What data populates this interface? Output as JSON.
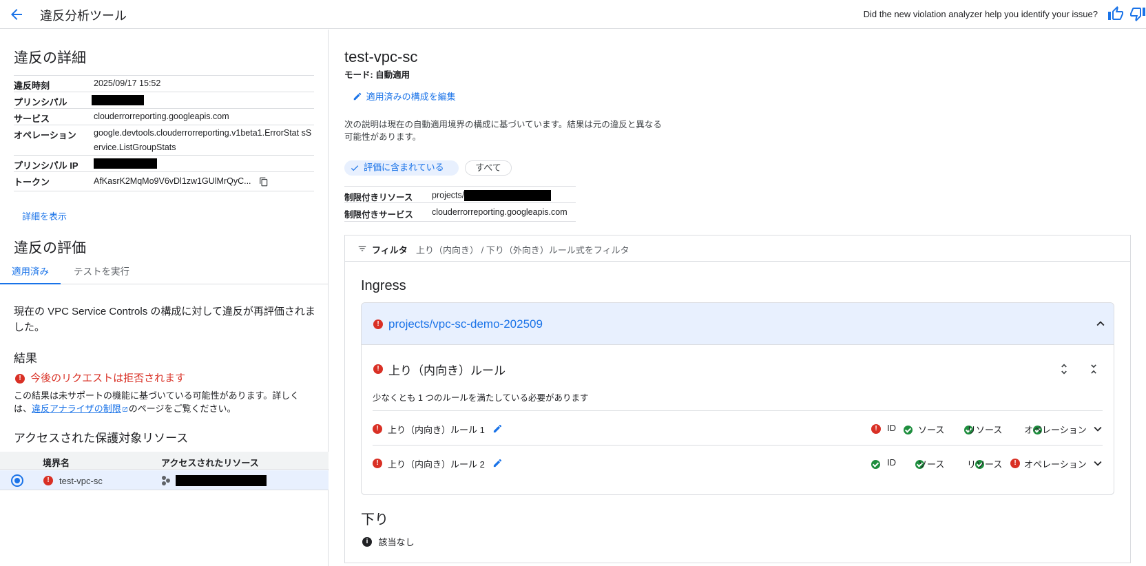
{
  "header": {
    "title": "違反分析ツール",
    "feedback_question": "Did the new violation analyzer help you identify your issue?"
  },
  "details": {
    "heading": "違反の詳細",
    "rows": [
      {
        "key": "違反時刻",
        "value": "2025/09/17 15:52"
      },
      {
        "key": "プリンシパル",
        "value": ""
      },
      {
        "key": "サービス",
        "value": "clouderrorreporting.googleapis.com"
      },
      {
        "key": "オペレーション",
        "value": "google.devtools.clouderrorreporting.v1beta1.ErrorStat sService.ListGroupStats"
      },
      {
        "key": "プリンシパル IP",
        "value": ""
      },
      {
        "key": "トークン",
        "value": "AfKasrK2MqMo9V6vDl1zw1GUlMrQyC..."
      }
    ],
    "show_more": "詳細を表示"
  },
  "evaluation": {
    "heading": "違反の評価",
    "tabs": [
      "適用済み",
      "テストを実行"
    ],
    "description": "現在の VPC Service Controls の構成に対して違反が再評価されました。",
    "result_heading": "結果",
    "result_text": "今後のリクエストは拒否されます",
    "note_prefix": "この結果は未サポートの機能に基づいている可能性があります。詳しくは、",
    "note_link": "違反アナライザの制限",
    "note_suffix": "のページをご覧ください。",
    "resources_heading": "アクセスされた保護対象リソース",
    "table_headers": [
      "境界名",
      "アクセスされたリソース"
    ],
    "table_rows": [
      {
        "perimeter": "test-vpc-sc",
        "resource": ""
      }
    ]
  },
  "perimeter": {
    "name": "test-vpc-sc",
    "mode": "モード: 自動適用",
    "edit_link": "適用済みの構成を編集",
    "explanation": "次の説明は現在の自動適用境界の構成に基づいています。結果は元の違反と異なる可能性があります。",
    "chip_selected": "評価に含まれている",
    "chip_all": "すべて",
    "restricted_resource_label": "制限付きリソース",
    "restricted_resource_value": "projects/",
    "restricted_service_label": "制限付きサービス",
    "restricted_service_value": "clouderrorreporting.googleapis.com"
  },
  "filter": {
    "label": "フィルタ",
    "placeholder": "上り（内向き） / 下り（外向き）ルール式をフィルタ"
  },
  "ingress": {
    "heading": "Ingress",
    "project": "projects/vpc-sc-demo-202509",
    "rules_heading": "上り（内向き）ルール",
    "rules_note": "少なくとも 1 つのルールを満たしている必要があります",
    "rules": [
      {
        "name": "上り（内向き）ルール 1",
        "checks": [
          {
            "label": "ID",
            "status": "error"
          },
          {
            "label": "ソース",
            "status": "ok"
          },
          {
            "label": "リソース",
            "status": "ok"
          },
          {
            "label": "オペレーション",
            "status": "ok"
          }
        ]
      },
      {
        "name": "上り（内向き）ルール 2",
        "checks": [
          {
            "label": "ID",
            "status": "ok"
          },
          {
            "label": "ソース",
            "status": "ok"
          },
          {
            "label": "リソース",
            "status": "ok"
          },
          {
            "label": "オペレーション",
            "status": "error"
          }
        ]
      }
    ]
  },
  "egress": {
    "heading": "下り",
    "none_text": "該当なし"
  },
  "colors": {
    "accent": "#1a73e8",
    "error": "#d93025",
    "ok": "#1e8e3e",
    "selected_bg": "#e8f0fe"
  }
}
